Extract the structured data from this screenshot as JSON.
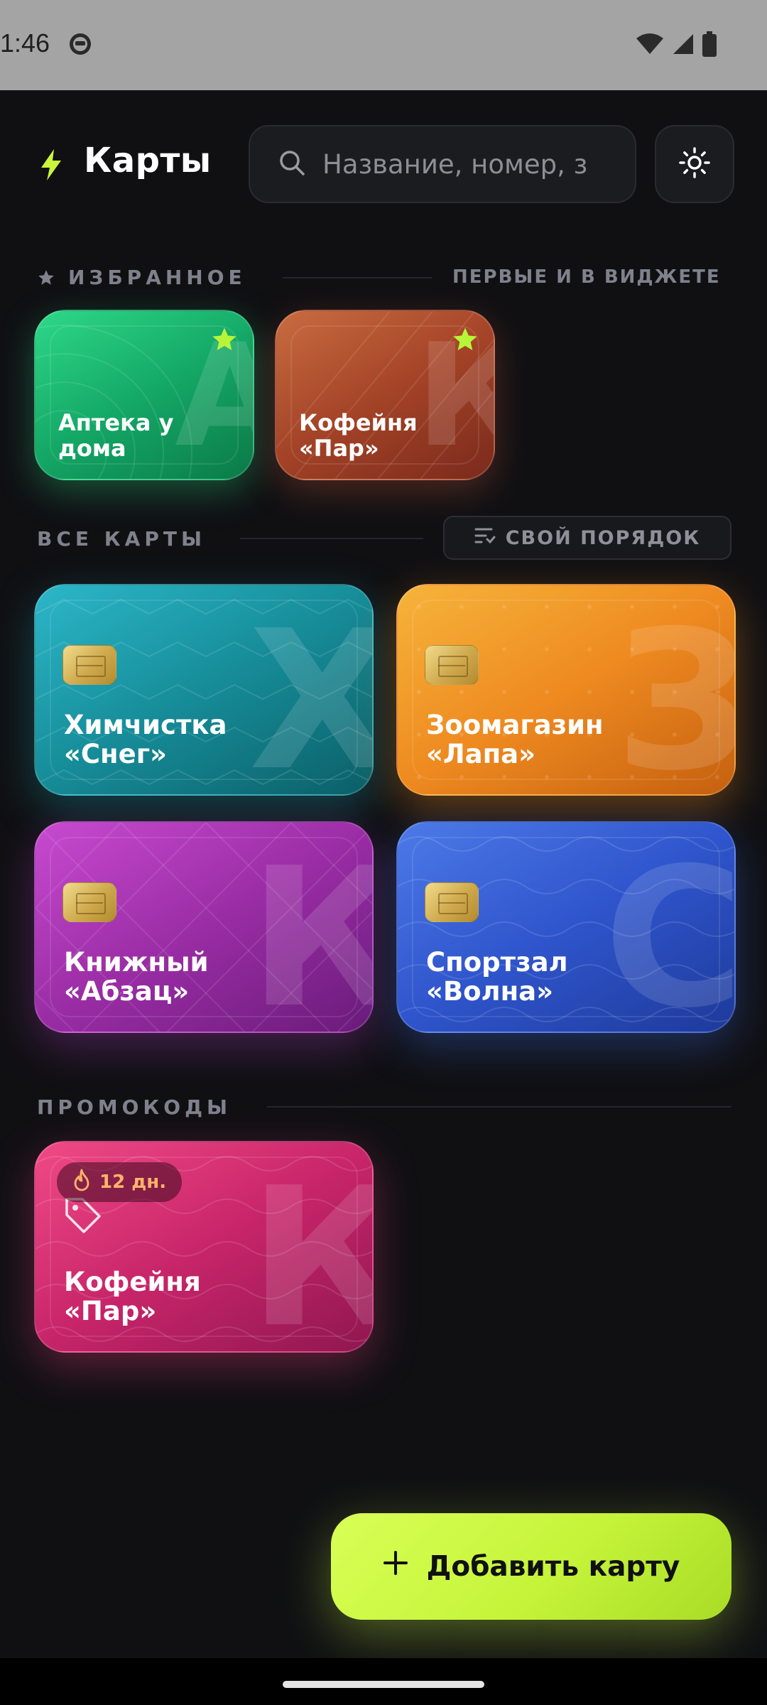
{
  "status_bar": {
    "time": "1:46"
  },
  "header": {
    "title": "Карты",
    "search_placeholder": "Название, номер, з"
  },
  "favorites": {
    "label": "ИЗБРАННОЕ",
    "aside": "ПЕРВЫЕ И В ВИДЖЕТЕ",
    "cards": [
      {
        "name": "Аптека у\nдома",
        "letter": "А",
        "starred": true
      },
      {
        "name": "Кофейня\n«Пар»",
        "letter": "К",
        "starred": true
      }
    ]
  },
  "all_cards": {
    "label": "ВСЕ КАРТЫ",
    "sort_label": "СВОЙ ПОРЯДОК",
    "cards": [
      {
        "name": "Химчистка\n«Снег»",
        "letter": "Х"
      },
      {
        "name": "Зоомагазин\n«Лапа»",
        "letter": "З"
      },
      {
        "name": "Книжный\n«Абзац»",
        "letter": "К"
      },
      {
        "name": "Спортзал\n«Волна»",
        "letter": "С"
      }
    ]
  },
  "promos": {
    "label": "ПРОМОКОДЫ",
    "cards": [
      {
        "name": "Кофейня\n«Пар»",
        "letter": "К",
        "badge": "12 дн."
      }
    ]
  },
  "fab": {
    "label": "Добавить карту"
  },
  "colors": {
    "background": "#101013",
    "accent": "#c9f63d",
    "star": "#b7f53a",
    "badge_text": "#ffb26a"
  },
  "icons": {
    "app_logo": "bolt-icon",
    "search": "search-icon",
    "theme": "sun-icon",
    "favorite": "star-icon",
    "sort": "sort-icon",
    "promo": "tag-icon",
    "expiry": "flame-icon",
    "add": "plus-icon"
  }
}
